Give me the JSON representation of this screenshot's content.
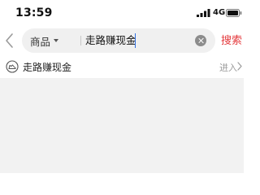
{
  "status_bar": {
    "time": "13:59",
    "network": "4G",
    "icons": [
      "signal-icon",
      "battery-icon"
    ]
  },
  "search_header": {
    "back_icon": "back-icon",
    "category": "商品",
    "query": "走路赚现金",
    "clear_icon": "clear-icon",
    "search_label": "搜索"
  },
  "suggestion": {
    "icon": "shoe-icon",
    "text": "走路赚现金",
    "action_label": "进入",
    "chevron_icon": "chevron-right-icon"
  },
  "colors": {
    "accent": "#e4393c",
    "page_background": "#f2f2f2",
    "search_box": "#f0f0f0",
    "cursor": "#2f6fe0"
  }
}
